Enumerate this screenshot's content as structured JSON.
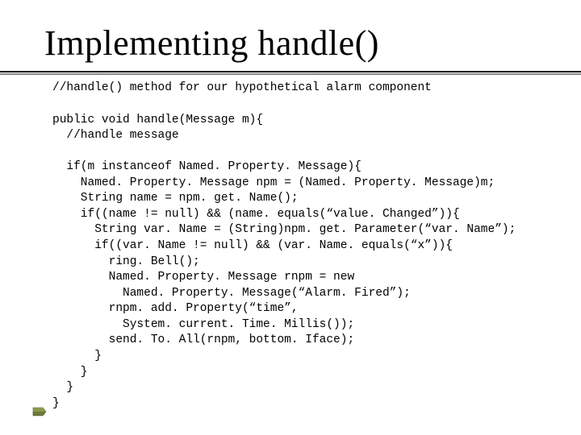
{
  "title": "Implementing handle()",
  "code": "//handle() method for our hypothetical alarm component\n\npublic void handle(Message m){\n  //handle message\n\n  if(m instanceof Named. Property. Message){\n    Named. Property. Message npm = (Named. Property. Message)m;\n    String name = npm. get. Name();\n    if((name != null) && (name. equals(“value. Changed”)){\n      String var. Name = (String)npm. get. Parameter(“var. Name”);\n      if((var. Name != null) && (var. Name. equals(“x”)){\n        ring. Bell();\n        Named. Property. Message rnpm = new\n          Named. Property. Message(“Alarm. Fired”);\n        rnpm. add. Property(“time”,\n          System. current. Time. Millis());\n        send. To. All(rnpm, bottom. Iface);\n      }\n    }\n  }\n}"
}
